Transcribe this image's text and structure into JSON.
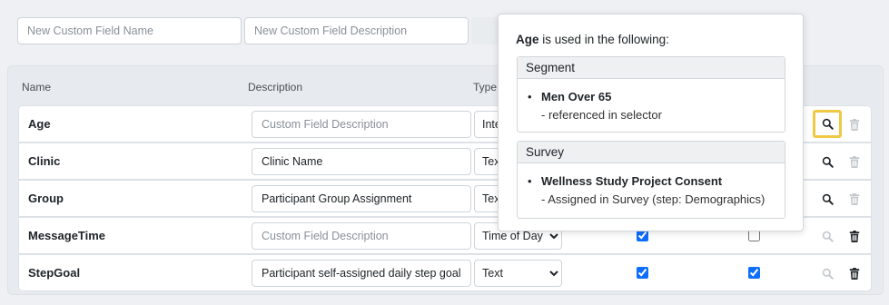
{
  "new_field": {
    "name_placeholder": "New Custom Field Name",
    "description_placeholder": "New Custom Field Description"
  },
  "table": {
    "headers": {
      "name": "Name",
      "description": "Description",
      "type": "Type"
    },
    "desc_placeholder": "Custom Field Description",
    "rows": [
      {
        "name": "Age",
        "description": "",
        "type": "Integer",
        "check1": false,
        "check2": false,
        "search_enabled": true,
        "delete_enabled": false
      },
      {
        "name": "Clinic",
        "description": "Clinic Name",
        "type": "Text",
        "check1": false,
        "check2": false,
        "search_enabled": true,
        "delete_enabled": false
      },
      {
        "name": "Group",
        "description": "Participant Group Assignment",
        "type": "Text",
        "check1": false,
        "check2": false,
        "search_enabled": true,
        "delete_enabled": false
      },
      {
        "name": "MessageTime",
        "description": "",
        "type": "Time of Day",
        "check1": true,
        "check2": false,
        "search_enabled": false,
        "delete_enabled": true
      },
      {
        "name": "StepGoal",
        "description": "Participant self-assigned daily step goal",
        "type": "Text",
        "check1": true,
        "check2": true,
        "search_enabled": false,
        "delete_enabled": true
      }
    ]
  },
  "popover": {
    "field_name": "Age",
    "title_suffix": " is used in the following:",
    "sections": [
      {
        "header": "Segment",
        "items": [
          {
            "name": "Men Over 65",
            "detail": "- referenced in selector"
          }
        ]
      },
      {
        "header": "Survey",
        "items": [
          {
            "name": "Wellness Study Project Consent",
            "detail": "- Assigned in Survey (step: Demographics)"
          }
        ]
      }
    ]
  },
  "colors": {
    "highlight": "#f0c944",
    "icon_active": "#212529",
    "icon_disabled": "#c4c8cc",
    "checkbox": "#0d6efd"
  },
  "icons": {
    "search": "search-icon",
    "delete": "trash-icon"
  }
}
